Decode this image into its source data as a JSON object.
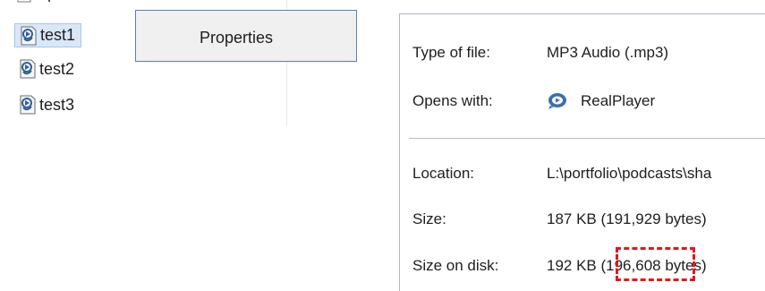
{
  "file_list": {
    "items": [
      {
        "name": "test1",
        "selected": true
      },
      {
        "name": "test2",
        "selected": false
      },
      {
        "name": "test3",
        "selected": false
      }
    ],
    "icon": "realplayer-file-icon"
  },
  "context_menu": {
    "item_label": "Properties"
  },
  "properties": {
    "type_of_file": {
      "label": "Type of file:",
      "value": "MP3 Audio (.mp3)"
    },
    "opens_with": {
      "label": "Opens with:",
      "value": "RealPlayer",
      "icon": "realplayer-app-icon"
    },
    "location": {
      "label": "Location:",
      "value": "L:\\portfolio\\podcasts\\sha"
    },
    "size": {
      "label": "Size:",
      "value": "187 KB (191,929 bytes)"
    },
    "size_on_disk": {
      "label": "Size on disk:",
      "value": "192 KB (196,608 bytes)"
    }
  },
  "colors": {
    "selection_bg": "#d9e7f7",
    "menu_border": "#5b7fb5",
    "highlight": "#e3171c"
  }
}
